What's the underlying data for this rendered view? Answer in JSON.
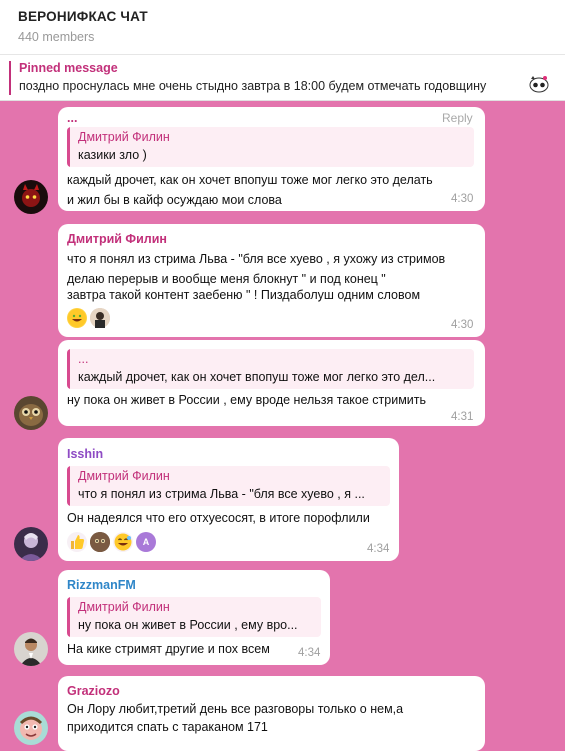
{
  "header": {
    "title": "ВЕРОНИФКАС ЧАТ",
    "members": "440 members"
  },
  "pinned": {
    "label": "Pinned message",
    "text": "поздно проснулась мне очень стыдно завтра в 18:00 будем отмечать годовщину"
  },
  "messages": [
    {
      "reply_label": "Reply",
      "quote": {
        "name": "...",
        "author": "Дмитрий Филин",
        "text": "казики зло )"
      },
      "lines": [
        "каждый дрочет, как он хочет впопуш тоже мог легко это делать",
        "и жил бы в кайф осуждаю мои слова"
      ],
      "time": "4:30"
    },
    {
      "sender": "Дмитрий Филин",
      "lines": [
        "что я понял из стрима Льва - \"бля все хуево , я ухожу из стримов",
        "делаю перерыв и вообще меня блокнут \" и под конец \"",
        "завтра такой контент заебеню \" ! Пиздаболуш одним словом"
      ],
      "reactions": [
        "grin-emoji",
        "user-avatar"
      ],
      "time": "4:30"
    },
    {
      "quote": {
        "name": "...",
        "text": "каждый дрочет, как он хочет впопуш тоже мог легко это дел..."
      },
      "lines": [
        "ну  пока он живет в России , ему вроде нельзя такое стримить"
      ],
      "time": "4:31"
    },
    {
      "sender": "Isshin",
      "quote": {
        "name": "Дмитрий Филин",
        "text": "что я понял из стрима Льва - \"бля все хуево , я ..."
      },
      "lines": [
        "Он надеялся что его отхуесосят, в итоге порофлили"
      ],
      "reactions": [
        "thumbs-up-emoji",
        "user-avatar",
        "grin-emoji",
        "letter-avatar"
      ],
      "reaction_letter": "A",
      "time": "4:34"
    },
    {
      "sender": "RizzmanFM",
      "quote": {
        "name": "Дмитрий Филин",
        "text": "ну  пока он живет в России , ему вро..."
      },
      "lines": [
        "На кике стримят другие и пох всем"
      ],
      "time": "4:34"
    },
    {
      "sender": "Graziozo",
      "lines": [
        "Он Лору любит,третий день все разговоры только о нем,а",
        "приходится спать с тараканом 171"
      ]
    }
  ],
  "colors": {
    "background": "#e374ad",
    "accent": "#c2307a",
    "isshin": "#8e4bc4",
    "rizzman": "#2f86c8",
    "graziozo": "#c2307a"
  }
}
